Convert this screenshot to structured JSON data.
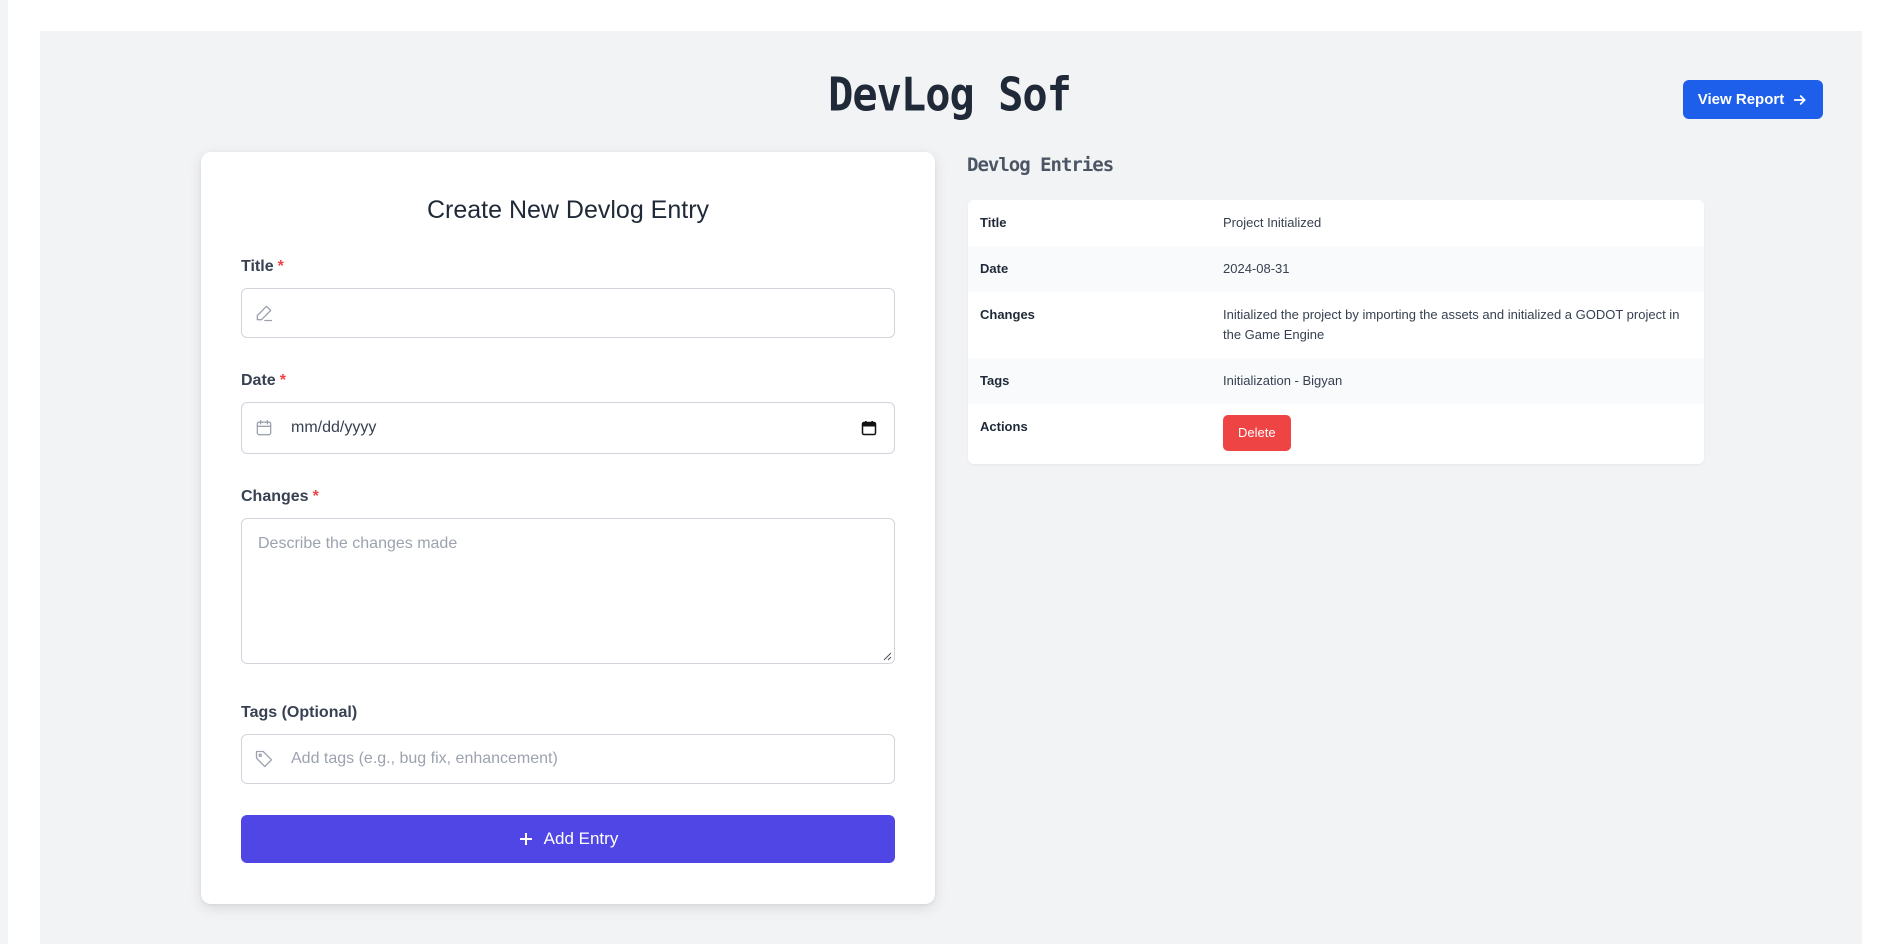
{
  "header": {
    "title": "DevLog Sof",
    "view_report_label": "View Report"
  },
  "form": {
    "heading": "Create New Devlog Entry",
    "title_label": "Title",
    "title_placeholder": "",
    "date_label": "Date",
    "date_placeholder": "mm/dd/yyyy",
    "changes_label": "Changes",
    "changes_placeholder": "Describe the changes made",
    "tags_label": "Tags (Optional)",
    "tags_placeholder": "Add tags (e.g., bug fix, enhancement)",
    "required_marker": "*",
    "submit_label": "Add Entry"
  },
  "entries": {
    "heading": "Devlog Entries",
    "rows": [
      {
        "key": "Title",
        "value": "Project Initialized"
      },
      {
        "key": "Date",
        "value": "2024-08-31"
      },
      {
        "key": "Changes",
        "value": "Initialized the project by importing the assets and initialized a GODOT project in the Game Engine"
      },
      {
        "key": "Tags",
        "value": "Initialization - Bigyan"
      },
      {
        "key": "Actions",
        "value": ""
      }
    ],
    "delete_label": "Delete"
  },
  "colors": {
    "primary": "#1d5fea",
    "accent": "#4f46e5",
    "danger": "#ef4444",
    "background": "#f2f3f5"
  },
  "icons": {
    "title_field": "pencil-icon",
    "date_field": "calendar-icon",
    "tags_field": "tag-icon",
    "view_report": "arrow-right-icon",
    "add_entry": "plus-icon"
  }
}
